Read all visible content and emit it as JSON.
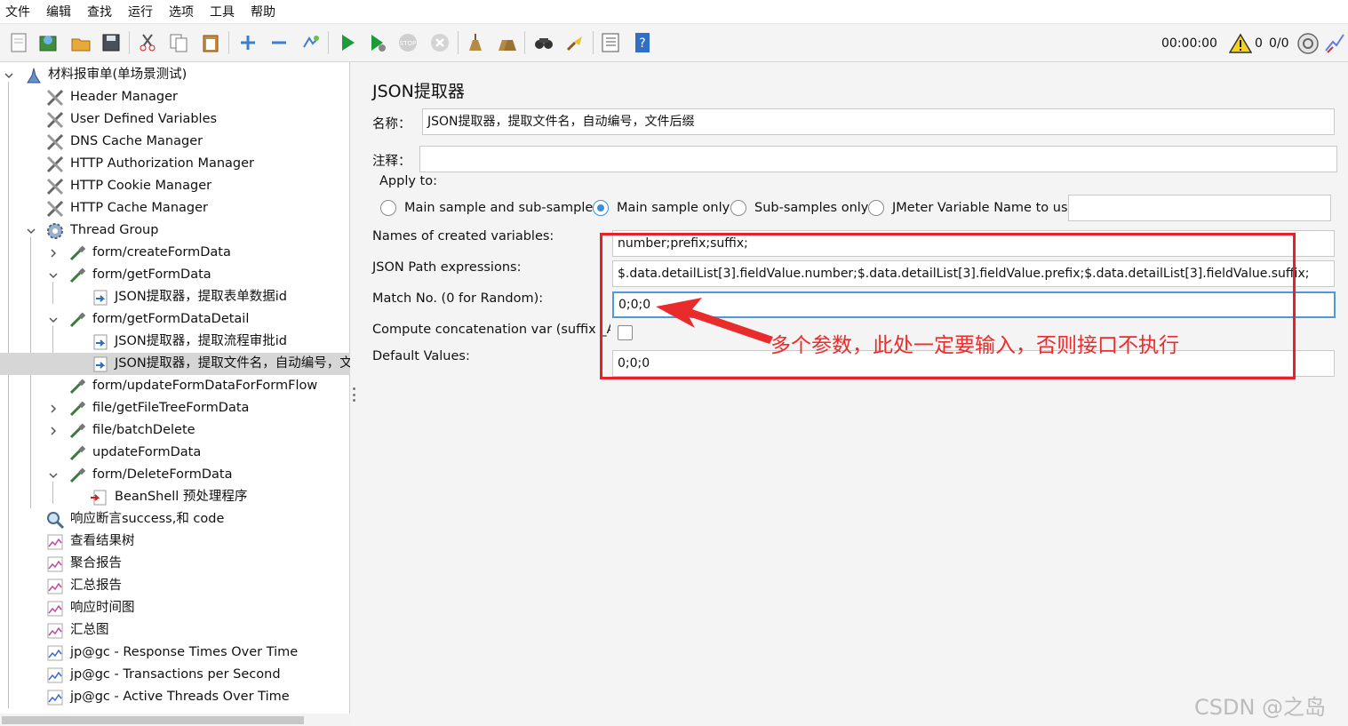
{
  "menu": [
    "文件",
    "编辑",
    "查找",
    "运行",
    "选项",
    "工具",
    "帮助"
  ],
  "toolbar": {
    "buttons": [
      "new-icon",
      "templates-icon",
      "open-icon",
      "save-icon",
      "cut-icon",
      "copy-icon",
      "paste-icon",
      "expand-icon",
      "collapse-icon",
      "toggle-icon",
      "start-icon",
      "start-no-pauses-icon",
      "stop-icon",
      "shutdown-icon",
      "clear-icon",
      "clear-all-icon",
      "search-icon",
      "reset-search-icon",
      "function-helper-icon",
      "help-icon"
    ],
    "elapsed": "00:00:00",
    "error_count": "0",
    "threads": "0/0"
  },
  "tree": {
    "root": "材料报审单(单场景测试)",
    "items": [
      "Header Manager",
      "User Defined Variables",
      "DNS Cache Manager",
      "HTTP Authorization Manager",
      "HTTP Cookie Manager",
      "HTTP Cache Manager",
      "Thread Group",
      "form/createFormData",
      "form/getFormData",
      "JSON提取器，提取表单数据id",
      "form/getFormDataDetail",
      "JSON提取器，提取流程审批id",
      "JSON提取器，提取文件名，自动编号，文",
      "form/updateFormDataForFormFlow",
      "file/getFileTreeFormData",
      "file/batchDelete",
      "updateFormData",
      "form/DeleteFormData",
      "BeanShell 预处理程序",
      "响应断言success,和 code",
      "查看结果树",
      "聚合报告",
      "汇总报告",
      "响应时间图",
      "汇总图",
      "jp@gc - Response Times Over Time",
      "jp@gc - Transactions per Second",
      "jp@gc - Active Threads Over Time"
    ]
  },
  "form": {
    "title": "JSON提取器",
    "name_label": "名称：",
    "name_value": "JSON提取器，提取文件名，自动编号，文件后缀",
    "comment_label": "注释：",
    "comment_value": "",
    "apply_to_label": "Apply to:",
    "apply_options": [
      "Main sample and sub-samples",
      "Main sample only",
      "Sub-samples only",
      "JMeter Variable Name to use"
    ],
    "apply_selected": "Main sample only",
    "jmeter_var_value": "",
    "names_label": "Names of created variables:",
    "names_value": "number;prefix;suffix;",
    "paths_label": "JSON Path expressions:",
    "paths_value": "$.data.detailList[3].fieldValue.number;$.data.detailList[3].fieldValue.prefix;$.data.detailList[3].fieldValue.suffix;",
    "match_label": "Match No. (0 for Random):",
    "match_value": "0;0;0",
    "concat_label": "Compute concatenation var (suffix _ALL):",
    "concat_checked": false,
    "default_label": "Default Values:",
    "default_value": "0;0;0"
  },
  "annotation": "多个参数，此处一定要输入，否则接口不执行",
  "watermark": "CSDN @之岛",
  "colors": {
    "annotation": "#ee2a2a",
    "selection": "#d6d6d6",
    "radio_on": "#3d8fd6",
    "focus_border": "#4e9ad8"
  }
}
